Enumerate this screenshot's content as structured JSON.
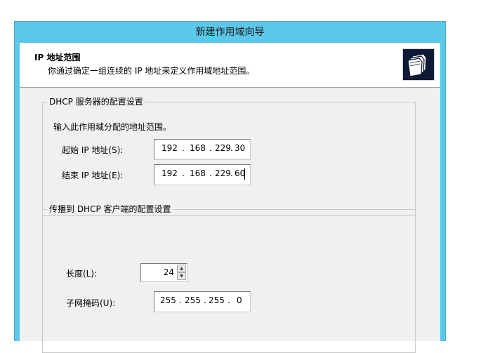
{
  "window": {
    "title": "新建作用域向导"
  },
  "header": {
    "title": "IP 地址范围",
    "description": "你通过确定一组连续的 IP 地址来定义作用域地址范围。",
    "icon": "folders-icon"
  },
  "dhcp_group": {
    "legend": "DHCP 服务器的配置设置",
    "instruction": "输入此作用域分配的地址范围。",
    "start_ip": {
      "label": "起始 IP 地址(S):",
      "octets": [
        "192",
        "168",
        "229",
        "30"
      ]
    },
    "end_ip": {
      "label": "结束 IP 地址(E):",
      "octets": [
        "192",
        "168",
        "229",
        "60"
      ]
    }
  },
  "client_group": {
    "legend": "传播到 DHCP 客户端的配置设置",
    "length": {
      "label": "长度(L):",
      "value": "24"
    },
    "subnet_mask": {
      "label": "子网掩码(U):",
      "octets": [
        "255",
        "255",
        "255",
        "0"
      ]
    }
  },
  "ip_separator": ".",
  "colors": {
    "titlebar": "#5bc8ea",
    "client_bg": "#f0f0f0",
    "icon_bg": "#0f1b36"
  }
}
